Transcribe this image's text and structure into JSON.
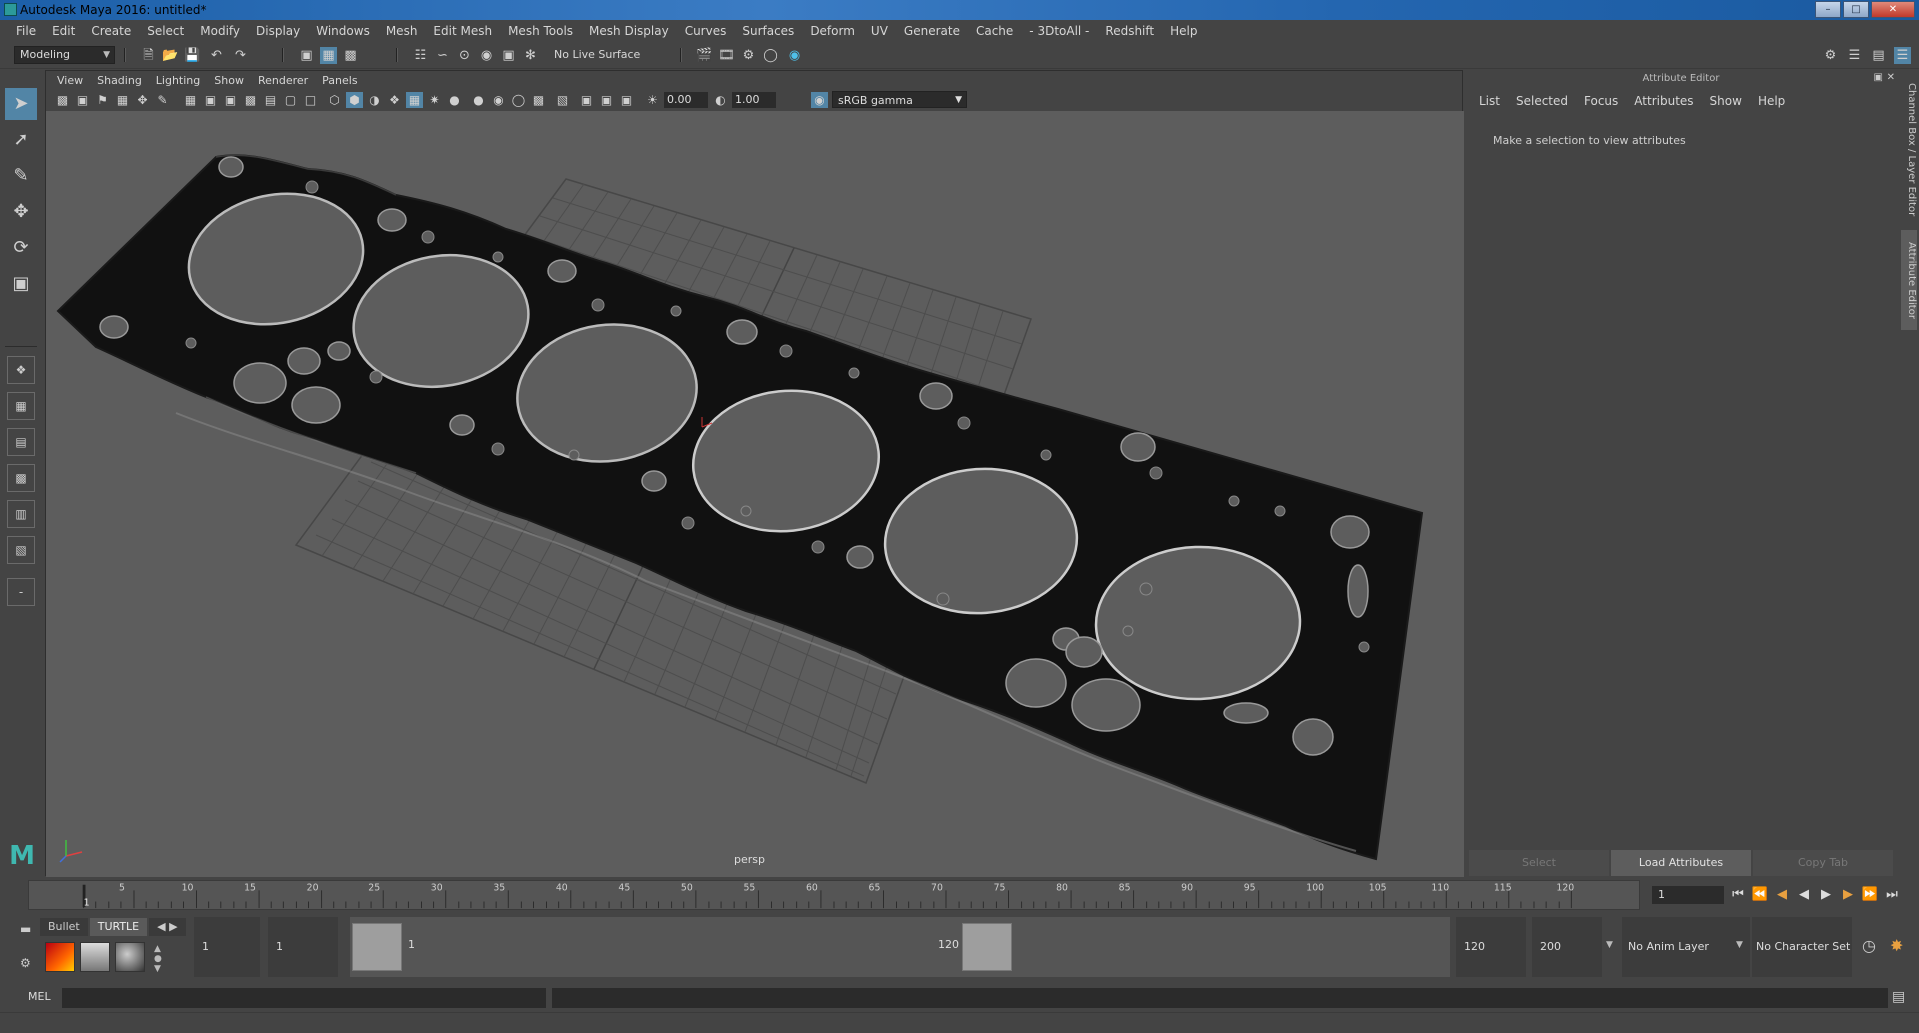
{
  "window": {
    "title": "Autodesk Maya 2016: untitled*"
  },
  "menubar": [
    "File",
    "Edit",
    "Create",
    "Select",
    "Modify",
    "Display",
    "Windows",
    "Mesh",
    "Edit Mesh",
    "Mesh Tools",
    "Mesh Display",
    "Curves",
    "Surfaces",
    "Deform",
    "UV",
    "Generate",
    "Cache",
    "- 3DtoAll -",
    "Redshift",
    "Help"
  ],
  "toolbar": {
    "mode": "Modeling",
    "live_surface": "No Live Surface"
  },
  "panel": {
    "menu": [
      "View",
      "Shading",
      "Lighting",
      "Show",
      "Renderer",
      "Panels"
    ],
    "exposure": "0.00",
    "gamma": "1.00",
    "color_space": "sRGB gamma",
    "camera_label": "persp"
  },
  "attribute_editor": {
    "title": "Attribute Editor",
    "menu": [
      "List",
      "Selected",
      "Focus",
      "Attributes",
      "Show",
      "Help"
    ],
    "message": "Make a selection to view attributes",
    "buttons": [
      "Select",
      "Load Attributes",
      "Copy Tab"
    ]
  },
  "side_tabs": {
    "channel_box": "Channel Box / Layer Editor",
    "attribute_editor": "Attribute Editor"
  },
  "timeslider": {
    "ticks": [
      5,
      10,
      15,
      20,
      25,
      30,
      35,
      40,
      45,
      50,
      55,
      60,
      65,
      70,
      75,
      80,
      85,
      90,
      95,
      100,
      105,
      110,
      115,
      120
    ],
    "start_label": "1",
    "current_frame": "1"
  },
  "shelf": {
    "tabs": [
      "Bullet",
      "TURTLE"
    ]
  },
  "range": {
    "start": "1",
    "playback_start": "1",
    "range_start_label": "1",
    "range_end_label": "120",
    "playback_end": "120",
    "end": "200",
    "anim_layer": "No Anim Layer",
    "character_set": "No Character Set"
  },
  "cmdline": {
    "label": "MEL"
  },
  "colors": {
    "accent": "#5285a6",
    "ui_bg": "#444444",
    "viewport_bg": "#5d5d5d"
  }
}
